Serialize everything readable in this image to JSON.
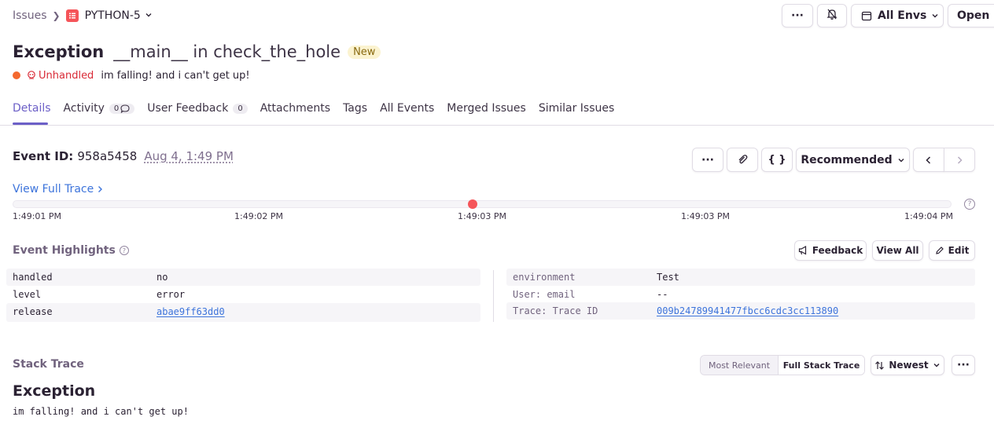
{
  "breadcrumb": {
    "root": "Issues",
    "project": "PYTHON-5"
  },
  "header": {
    "more_label": "···",
    "env_label": "All Envs",
    "open_label": "Open in"
  },
  "issue": {
    "title_type": "Exception",
    "title_location": "__main__ in check_the_hole",
    "badge": "New",
    "handled_label": "Unhandled",
    "message": "im falling! and i can't get up!"
  },
  "tabs": [
    {
      "label": "Details",
      "count": null
    },
    {
      "label": "Activity",
      "count": "0"
    },
    {
      "label": "User Feedback",
      "count": "0"
    },
    {
      "label": "Attachments",
      "count": null
    },
    {
      "label": "Tags",
      "count": null
    },
    {
      "label": "All Events",
      "count": null
    },
    {
      "label": "Merged Issues",
      "count": null
    },
    {
      "label": "Similar Issues",
      "count": null
    }
  ],
  "event": {
    "id_label": "Event ID:",
    "id": "958a5458",
    "date": "Aug 4, 1:49 PM",
    "recommended_label": "Recommended",
    "json_label": "{ }"
  },
  "trace": {
    "link_label": "View Full Trace",
    "ticks": [
      "1:49:01 PM",
      "1:49:02 PM",
      "1:49:03 PM",
      "1:49:03 PM",
      "1:49:04 PM"
    ],
    "marker_fraction": 0.49,
    "help": "?"
  },
  "highlights": {
    "title": "Event Highlights",
    "feedback_label": "Feedback",
    "view_all_label": "View All",
    "edit_label": "Edit",
    "left": [
      {
        "key": "handled",
        "value": "no"
      },
      {
        "key": "level",
        "value": "error"
      },
      {
        "key": "release",
        "value": "abae9ff63dd0"
      }
    ],
    "right": [
      {
        "key": "environment",
        "value": "Test"
      },
      {
        "key": "User: email",
        "value": "--"
      },
      {
        "key": "Trace: Trace ID",
        "value": "009b24789941477fbcc6cdc3cc113890"
      }
    ]
  },
  "stack": {
    "title": "Stack Trace",
    "option_relevant": "Most Relevant",
    "option_full": "Full Stack Trace",
    "sort_label": "Newest",
    "exception_type": "Exception",
    "exception_message": "im falling! and i can't get up!"
  },
  "colors": {
    "accent": "#6c5fc7",
    "error": "#d92a36",
    "link": "#3d74db",
    "marker": "#f55459",
    "level_dot": "#f4692f"
  }
}
